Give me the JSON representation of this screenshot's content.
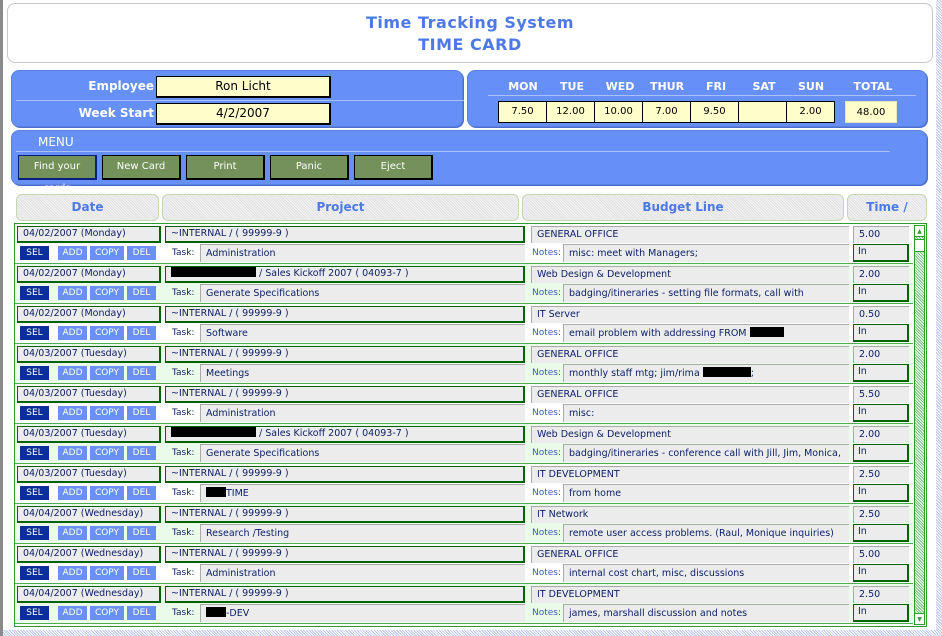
{
  "header": {
    "title": "Time Tracking System",
    "subtitle": "TIME CARD"
  },
  "employee": {
    "employee_label": "Employee",
    "employee_value": "Ron Licht",
    "week_start_label": "Week Start",
    "week_start_value": "4/2/2007"
  },
  "week": {
    "days": [
      {
        "label": "MON",
        "value": "7.50"
      },
      {
        "label": "TUE",
        "value": "12.00"
      },
      {
        "label": "WED",
        "value": "10.00"
      },
      {
        "label": "THUR",
        "value": "7.00"
      },
      {
        "label": "FRI",
        "value": "9.50"
      },
      {
        "label": "SAT",
        "value": ""
      },
      {
        "label": "SUN",
        "value": "2.00"
      }
    ],
    "total_label": "TOTAL",
    "total_value": "48.00"
  },
  "menu": {
    "title": "MENU",
    "buttons": [
      "Find your cards",
      "New Card",
      "Print",
      "Panic",
      "Eject"
    ]
  },
  "columns": {
    "date": "Date",
    "project": "Project",
    "budget": "Budget Line",
    "time": "Time / Scope"
  },
  "row_labels": {
    "sel": "SEL",
    "add": "ADD",
    "copy": "COPY",
    "del": "DEL",
    "task": "Task:",
    "notes": "Notes:"
  },
  "colors": {
    "accent_blue": "#6690f6",
    "title_blue": "#4d79e6",
    "menu_button_green": "#739158",
    "sel_button": "#0b2e9c",
    "row_border_green": "#006400",
    "field_yellow": "#ffffcc"
  },
  "entries": [
    {
      "date": "04/02/2007 (Monday)",
      "project_redacted": false,
      "project": "~INTERNAL /  ( 99999-9 )",
      "task_redacted": false,
      "task": "Administration",
      "budget": "GENERAL OFFICE",
      "notes": "misc: meet with Managers;",
      "notes_redacted": false,
      "notes_after": "",
      "hours": "5.00",
      "scope": "In"
    },
    {
      "date": "04/02/2007 (Monday)",
      "project_redacted": true,
      "project": " / Sales Kickoff 2007 ( 04093-7 )",
      "task_redacted": false,
      "task": "Generate Specifications",
      "budget": "Web Design & Development",
      "notes": "badging/itineraries - setting file formats, call with",
      "notes_redacted": false,
      "notes_after": "",
      "hours": "2.00",
      "scope": "In"
    },
    {
      "date": "04/02/2007 (Monday)",
      "project_redacted": false,
      "project": "~INTERNAL /  ( 99999-9 )",
      "task_redacted": false,
      "task": "Software",
      "budget": "IT Server",
      "notes": "email problem with addressing FROM ",
      "notes_redacted": true,
      "notes_after": "",
      "hours": "0.50",
      "scope": "In"
    },
    {
      "date": "04/03/2007 (Tuesday)",
      "project_redacted": false,
      "project": "~INTERNAL /  ( 99999-9 )",
      "task_redacted": false,
      "task": "Meetings",
      "budget": "GENERAL OFFICE",
      "notes": "monthly staff mtg; jim/rima ",
      "notes_redacted": true,
      "notes_after": ";",
      "hours": "2.00",
      "scope": "In"
    },
    {
      "date": "04/03/2007 (Tuesday)",
      "project_redacted": false,
      "project": "~INTERNAL /  ( 99999-9 )",
      "task_redacted": false,
      "task": "Administration",
      "budget": "GENERAL OFFICE",
      "notes": "misc:",
      "notes_redacted": false,
      "notes_after": "",
      "hours": "5.50",
      "scope": "In"
    },
    {
      "date": "04/03/2007 (Tuesday)",
      "project_redacted": true,
      "project": " / Sales Kickoff 2007 ( 04093-7 )",
      "task_redacted": false,
      "task": "Generate Specifications",
      "budget": "Web Design & Development",
      "notes": "badging/itineraries - conference call with Jill, Jim, Monica,",
      "notes_redacted": false,
      "notes_after": "",
      "hours": "2.00",
      "scope": "In"
    },
    {
      "date": "04/03/2007 (Tuesday)",
      "project_redacted": false,
      "project": "~INTERNAL /  ( 99999-9 )",
      "task_redacted": true,
      "task": "TIME",
      "budget": "IT DEVELOPMENT",
      "notes": "from home",
      "notes_redacted": false,
      "notes_after": "",
      "hours": "2.50",
      "scope": "In"
    },
    {
      "date": "04/04/2007 (Wednesday)",
      "project_redacted": false,
      "project": "~INTERNAL /  ( 99999-9 )",
      "task_redacted": false,
      "task": "Research /Testing",
      "budget": "IT Network",
      "notes": "remote user access problems.  (Raul, Monique inquiries)",
      "notes_redacted": false,
      "notes_after": "",
      "hours": "2.50",
      "scope": "In"
    },
    {
      "date": "04/04/2007 (Wednesday)",
      "project_redacted": false,
      "project": "~INTERNAL /  ( 99999-9 )",
      "task_redacted": false,
      "task": "Administration",
      "budget": "GENERAL OFFICE",
      "notes": "internal cost chart, misc, discussions",
      "notes_redacted": false,
      "notes_after": "",
      "hours": "5.00",
      "scope": "In"
    },
    {
      "date": "04/04/2007 (Wednesday)",
      "project_redacted": false,
      "project": "~INTERNAL /  ( 99999-9 )",
      "task_redacted": true,
      "task": "-DEV",
      "budget": "IT DEVELOPMENT",
      "notes": "james, marshall discussion and notes",
      "notes_redacted": false,
      "notes_after": "",
      "hours": "2.50",
      "scope": "In"
    }
  ]
}
